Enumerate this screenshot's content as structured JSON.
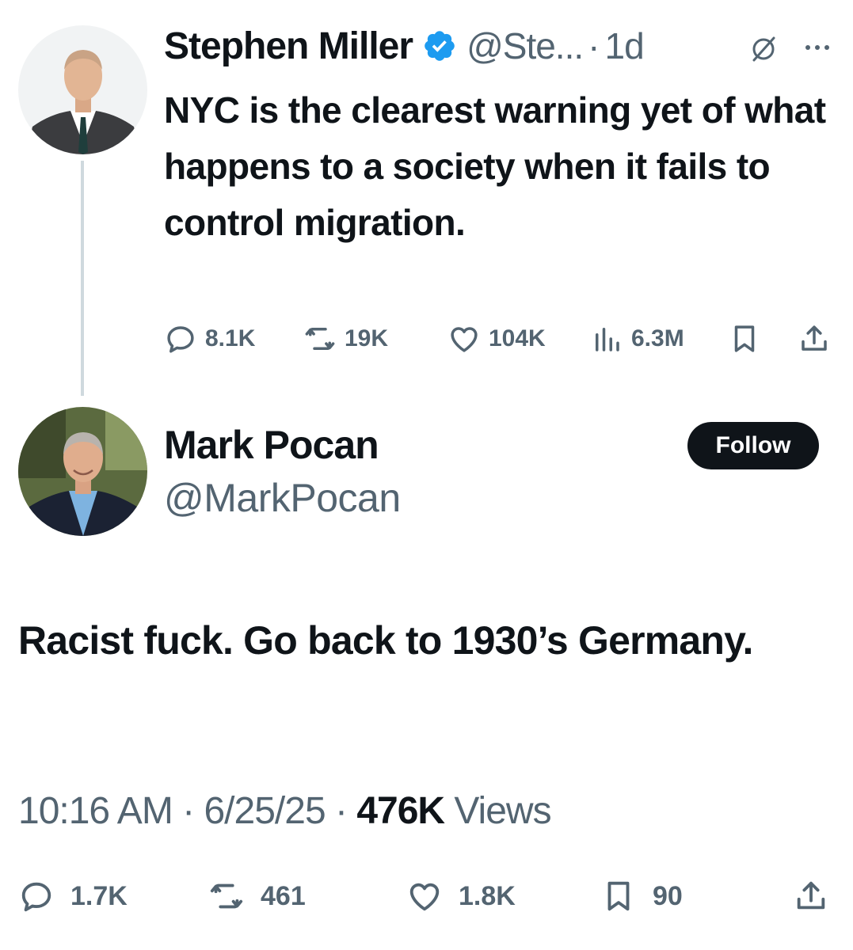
{
  "quoted_tweet": {
    "author_name": "Stephen Miller",
    "handle": "@Ste...",
    "separator": "·",
    "time": "1d",
    "text": "NYC is the clearest warning yet of what happens to a society when it fails to control migration.",
    "stats": {
      "replies": "8.1K",
      "reposts": "19K",
      "likes": "104K",
      "views": "6.3M"
    }
  },
  "tweet": {
    "author_name": "Mark Pocan",
    "handle": "@MarkPocan",
    "follow_label": "Follow",
    "text": "Racist fuck. Go back to 1930’s Germany.",
    "time": "10:16 AM",
    "date": "6/25/25",
    "views_count": "476K",
    "views_label": "Views",
    "separator": "·",
    "stats": {
      "replies": "1.7K",
      "reposts": "461",
      "likes": "1.8K",
      "bookmarks": "90"
    }
  },
  "colors": {
    "text": "#0f1419",
    "secondary": "#536471",
    "verified": "#1d9bf0",
    "thread_line": "#cfd9de",
    "follow_bg": "#0f1419"
  }
}
